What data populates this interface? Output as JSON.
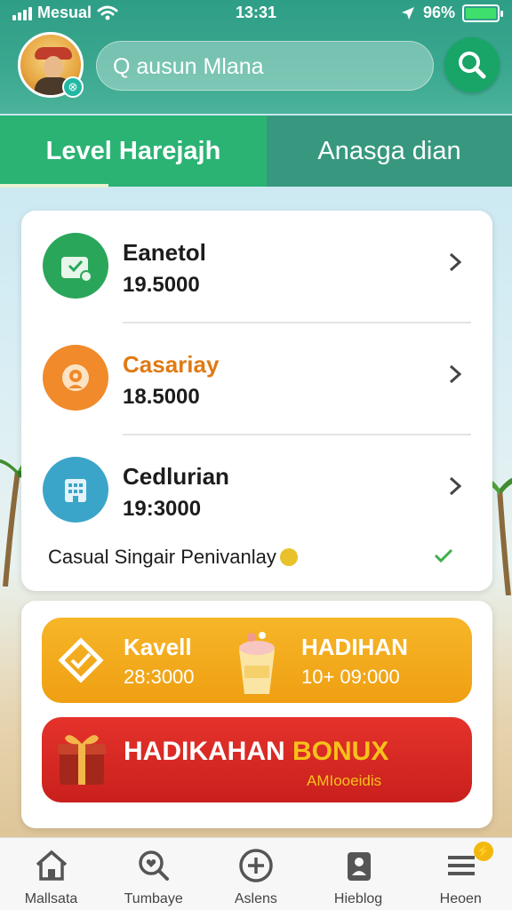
{
  "status_bar": {
    "carrier": "Mesual",
    "time": "13:31",
    "battery": "96%"
  },
  "header": {
    "search_placeholder": "Q ausun Mlana",
    "avatar_badge": "⊗"
  },
  "tabs": [
    {
      "label": "Level Harejajh",
      "active": true
    },
    {
      "label": "Anasga dian",
      "active": false
    }
  ],
  "list": {
    "items": [
      {
        "title": "Eanetol",
        "value": "19.5000",
        "icon": "wallet-icon",
        "color": "#2aa65a",
        "title_color": "#1c1c1c"
      },
      {
        "title": "Casariay",
        "value": "18.5000",
        "icon": "badge-icon",
        "color": "#f08a2a",
        "title_color": "#e07a14"
      },
      {
        "title": "Cedlurian",
        "value": "19:3000",
        "icon": "building-icon",
        "color": "#3aa5c9",
        "title_color": "#1c1c1c"
      }
    ],
    "footer_text": "Casual  Singair Penivanlay",
    "footer_emoji": "smile-emoji"
  },
  "rewards": {
    "item1_label": "Kavell",
    "item1_value": "28:3000",
    "item2_label": "HADIHAN",
    "item2_value": "10+ 09:000",
    "bonus_label_a": "HADIKAHAN",
    "bonus_label_b": "BONUX",
    "bonus_sub": "AMIooeidis"
  },
  "colors": {
    "header": "#2f9e86",
    "tab_active": "#2bb374",
    "tab_inactive": "#37987f",
    "reward_orange": "#f2a81c",
    "bonus_red": "#d7271f",
    "bonus_yellow": "#f6c21a"
  },
  "bottom_nav": [
    {
      "label": "Mallsata",
      "icon": "home-icon"
    },
    {
      "label": "Tumbaye",
      "icon": "search-heart-icon"
    },
    {
      "label": "Aslens",
      "icon": "plus-circle-icon"
    },
    {
      "label": "Hieblog",
      "icon": "profile-icon"
    },
    {
      "label": "Heoen",
      "icon": "menu-icon",
      "badge": "⚡"
    }
  ]
}
